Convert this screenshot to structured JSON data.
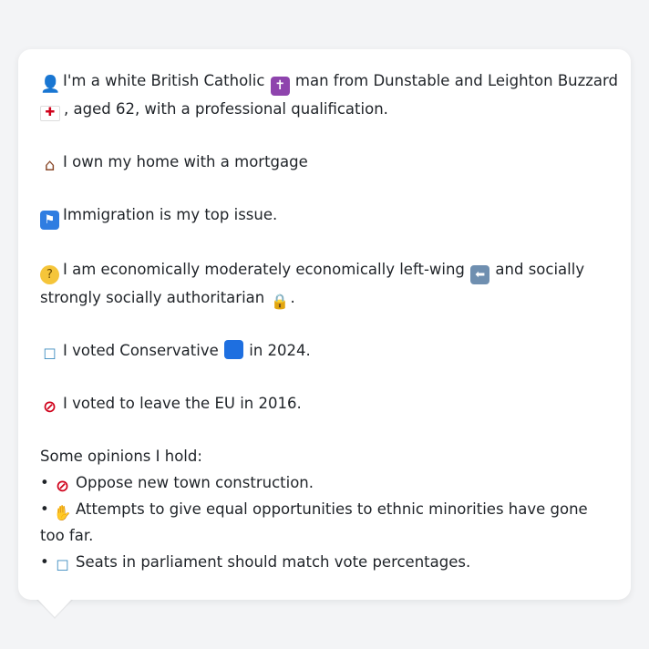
{
  "profile": {
    "intro_a": "I'm a white British Catholic",
    "intro_b": "man from Dunstable and Leighton Buzzard",
    "intro_c": ", aged 62, with a professional qualification.",
    "housing": "I own my home with a mortgage",
    "top_issue": "Immigration is my top issue.",
    "politics_a": "I am economically moderately economically left-wing",
    "politics_b": "and socially",
    "politics_c": "strongly socially authoritarian",
    "politics_d": ".",
    "vote_a": "I voted Conservative",
    "vote_b": "in 2024.",
    "eu_vote": "I voted to leave the EU in 2016.",
    "opinions_heading": "Some opinions I hold:",
    "opinions": [
      "Oppose new town construction.",
      "Attempts to give equal opportunities to ethnic minorities have gone too far.",
      "Seats in parliament should match vote percentages."
    ],
    "bullet": "•"
  },
  "icons": {
    "user": "bust-silhouette-icon",
    "cross": "latin-cross-icon",
    "flag": "england-flag-icon",
    "house": "house-icon",
    "immigration": "passport-control-icon",
    "thinking": "thinking-face-icon",
    "left": "left-arrow-icon",
    "lock": "locked-padlock-icon",
    "ballot": "ballot-box-icon",
    "party": "blue-square-icon",
    "prohibited": "prohibited-icon",
    "handshake": "handshake-icon"
  },
  "colors": {
    "background": "#f3f4f6",
    "card": "#ffffff",
    "text": "#1f2328",
    "conservative_blue": "#1e6fe0"
  }
}
